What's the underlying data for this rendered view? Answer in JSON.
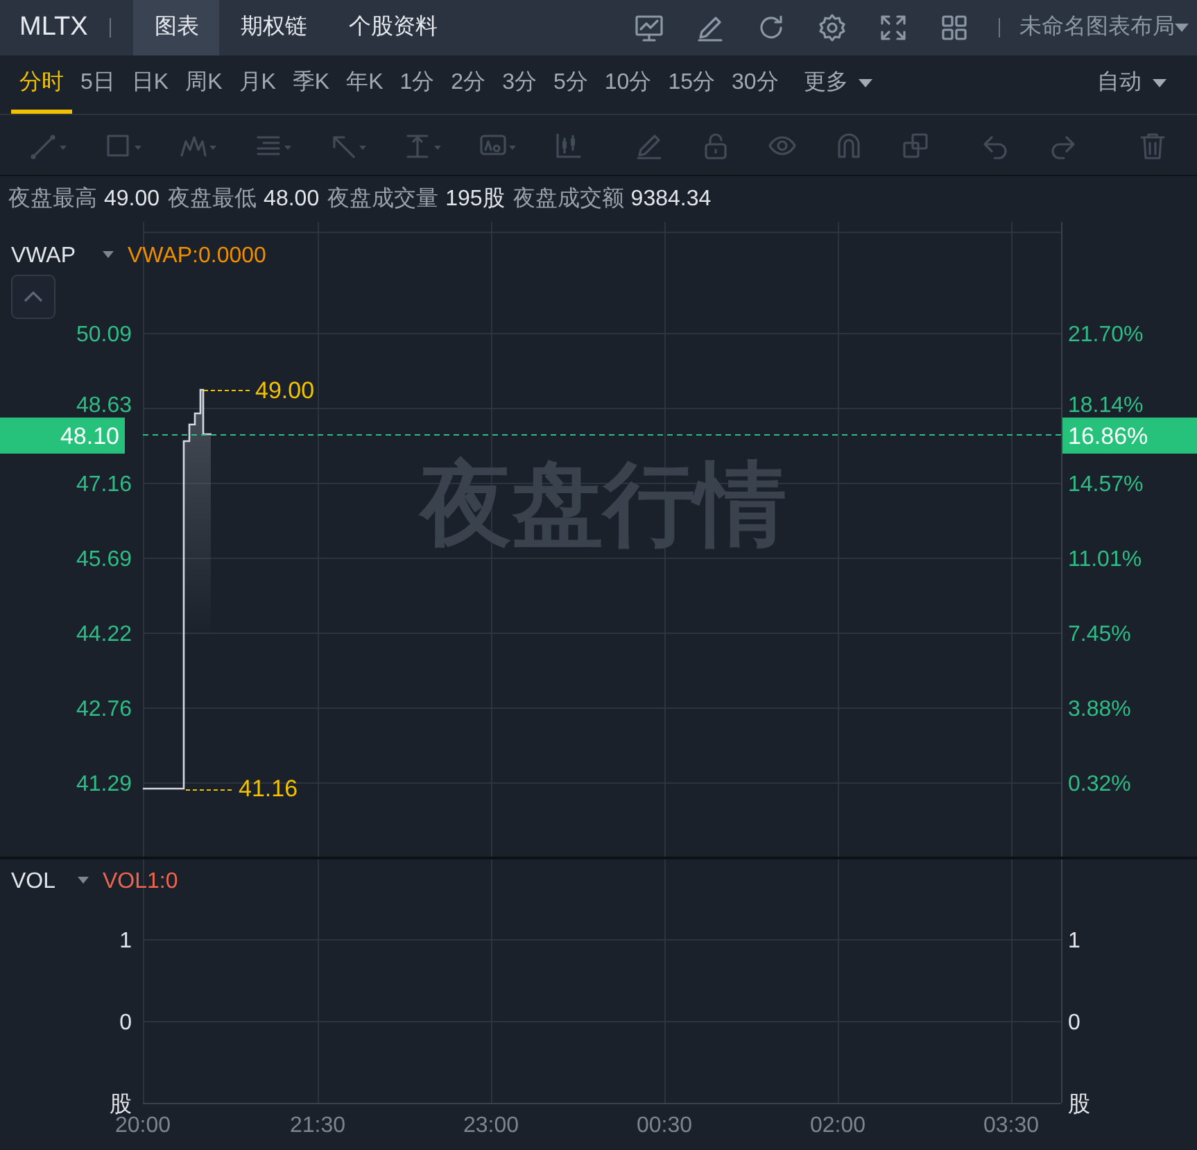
{
  "header": {
    "symbol": "MLTX",
    "tabs": [
      {
        "label": "图表",
        "selected": true
      },
      {
        "label": "期权链",
        "selected": false
      },
      {
        "label": "个股资料",
        "selected": false
      }
    ],
    "layout_name": "未命名图表布局"
  },
  "periods": [
    {
      "label": "分时",
      "selected": true
    },
    {
      "label": "5日",
      "selected": false
    },
    {
      "label": "日K",
      "selected": false
    },
    {
      "label": "周K",
      "selected": false
    },
    {
      "label": "月K",
      "selected": false
    },
    {
      "label": "季K",
      "selected": false
    },
    {
      "label": "年K",
      "selected": false
    },
    {
      "label": "1分",
      "selected": false
    },
    {
      "label": "2分",
      "selected": false
    },
    {
      "label": "3分",
      "selected": false
    },
    {
      "label": "5分",
      "selected": false
    },
    {
      "label": "10分",
      "selected": false
    },
    {
      "label": "15分",
      "selected": false
    },
    {
      "label": "30分",
      "selected": false
    }
  ],
  "more": "更多",
  "mode": "自动",
  "stats": [
    {
      "label": "夜盘最高",
      "value": "49.00"
    },
    {
      "label": "夜盘最低",
      "value": "48.00"
    },
    {
      "label": "夜盘成交量",
      "value": "195股"
    },
    {
      "label": "夜盘成交额",
      "value": "9384.34"
    }
  ],
  "price_pane": {
    "indicator": "VWAP",
    "indicator_value": "VWAP:0.0000",
    "session_label": "夜盘行情",
    "left_axis": [
      "50.09",
      "48.63",
      "47.16",
      "45.69",
      "44.22",
      "42.76",
      "41.29"
    ],
    "right_axis": [
      "21.70%",
      "18.14%",
      "14.57%",
      "11.01%",
      "7.45%",
      "3.88%",
      "0.32%"
    ],
    "current_price": "48.10",
    "current_change": "16.86%",
    "high_label": "49.00",
    "low_label": "41.16"
  },
  "volume_pane": {
    "indicator": "VOL",
    "indicator_value": "VOL1:0",
    "left_axis": [
      "1",
      "0",
      "股"
    ],
    "right_axis": [
      "1",
      "0",
      "股"
    ]
  },
  "time_axis": [
    "20:00",
    "21:30",
    "23:00",
    "00:30",
    "02:00",
    "03:30"
  ]
}
